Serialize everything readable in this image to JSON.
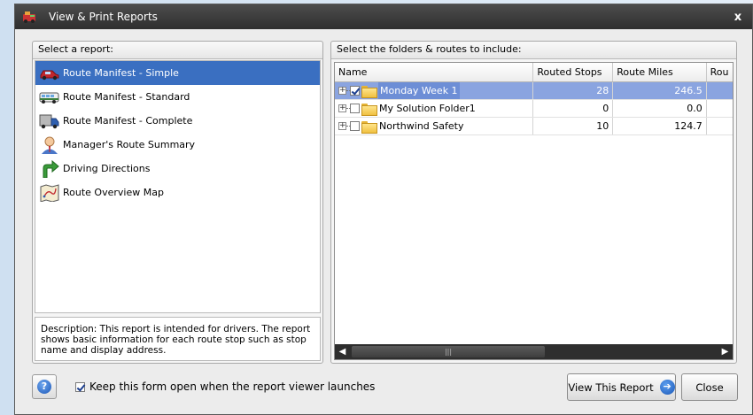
{
  "window": {
    "title": "View & Print Reports",
    "close_glyph": "x"
  },
  "left_panel": {
    "header": "Select a report:",
    "reports": [
      {
        "label": "Route Manifest - Simple",
        "icon": "car-icon",
        "selected": true
      },
      {
        "label": "Route Manifest - Standard",
        "icon": "bus-icon",
        "selected": false
      },
      {
        "label": "Route Manifest - Complete",
        "icon": "truck-icon",
        "selected": false
      },
      {
        "label": "Manager's Route Summary",
        "icon": "manager-icon",
        "selected": false
      },
      {
        "label": "Driving Directions",
        "icon": "directions-arrow-icon",
        "selected": false
      },
      {
        "label": "Route Overview Map",
        "icon": "map-icon",
        "selected": false
      }
    ],
    "description": "Description: This report is intended for drivers.  The report shows basic information for each route stop such as stop name and display address."
  },
  "right_panel": {
    "header": "Select the folders & routes to include:",
    "columns": [
      "Name",
      "Routed Stops",
      "Route Miles",
      "Rou"
    ],
    "rows": [
      {
        "name": "Monday Week 1",
        "routed_stops": "28",
        "route_miles": "246.5",
        "checked": true,
        "selected": true
      },
      {
        "name": "My Solution Folder1",
        "routed_stops": "0",
        "route_miles": "0.0",
        "checked": false,
        "selected": false
      },
      {
        "name": "Northwind Safety",
        "routed_stops": "10",
        "route_miles": "124.7",
        "checked": false,
        "selected": false
      }
    ],
    "scroll_left": "◀",
    "scroll_right": "▶",
    "scroll_grip": "|||"
  },
  "footer": {
    "help_glyph": "?",
    "keep_open_label": "Keep this form open when the report viewer launches",
    "keep_open_checked": true,
    "view_report_label": "View This Report",
    "view_report_glyph": "➔",
    "close_label": "Close"
  },
  "colors": {
    "titlebar": "#3a3a3a",
    "selection": "#3a6fc1",
    "grid_selection": "#8aa4e0",
    "window_bg": "#ececec"
  }
}
